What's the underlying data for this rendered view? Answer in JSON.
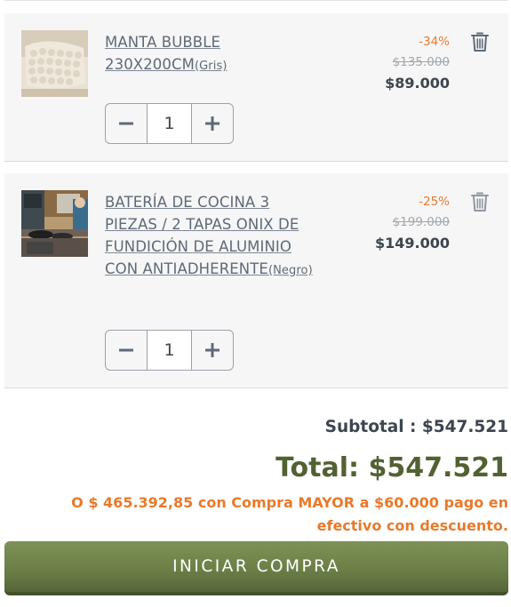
{
  "cart": {
    "items": [
      {
        "name": "MANTA BUBBLE 230X200CM",
        "variant": "(Gris)",
        "discount": "-34%",
        "old_price": "$135.000",
        "price": "$89.000",
        "quantity": "1",
        "image_icon": "blanket-photo"
      },
      {
        "name": "BATERÍA DE COCINA 3 PIEZAS / 2 TAPAS ONIX DE FUNDICIÓN DE ALUMINIO CON ANTIADHERENTE",
        "variant": "(Negro)",
        "discount": "-25%",
        "old_price": "$199.000",
        "price": "$149.000",
        "quantity": "1",
        "image_icon": "cookware-photo"
      }
    ]
  },
  "summary": {
    "subtotal": "Subtotal : $547.521",
    "total": "Total: $547.521",
    "cash_discount_note": "O $ 465.392,85 con Compra MAYOR a $60.000 pago en efectivo con descuento."
  },
  "checkout": {
    "button_label": "INICIAR COMPRA"
  },
  "colors": {
    "discount": "#e87a2c",
    "total": "#526132",
    "button": "#6d7f47",
    "text": "#3d4550"
  }
}
